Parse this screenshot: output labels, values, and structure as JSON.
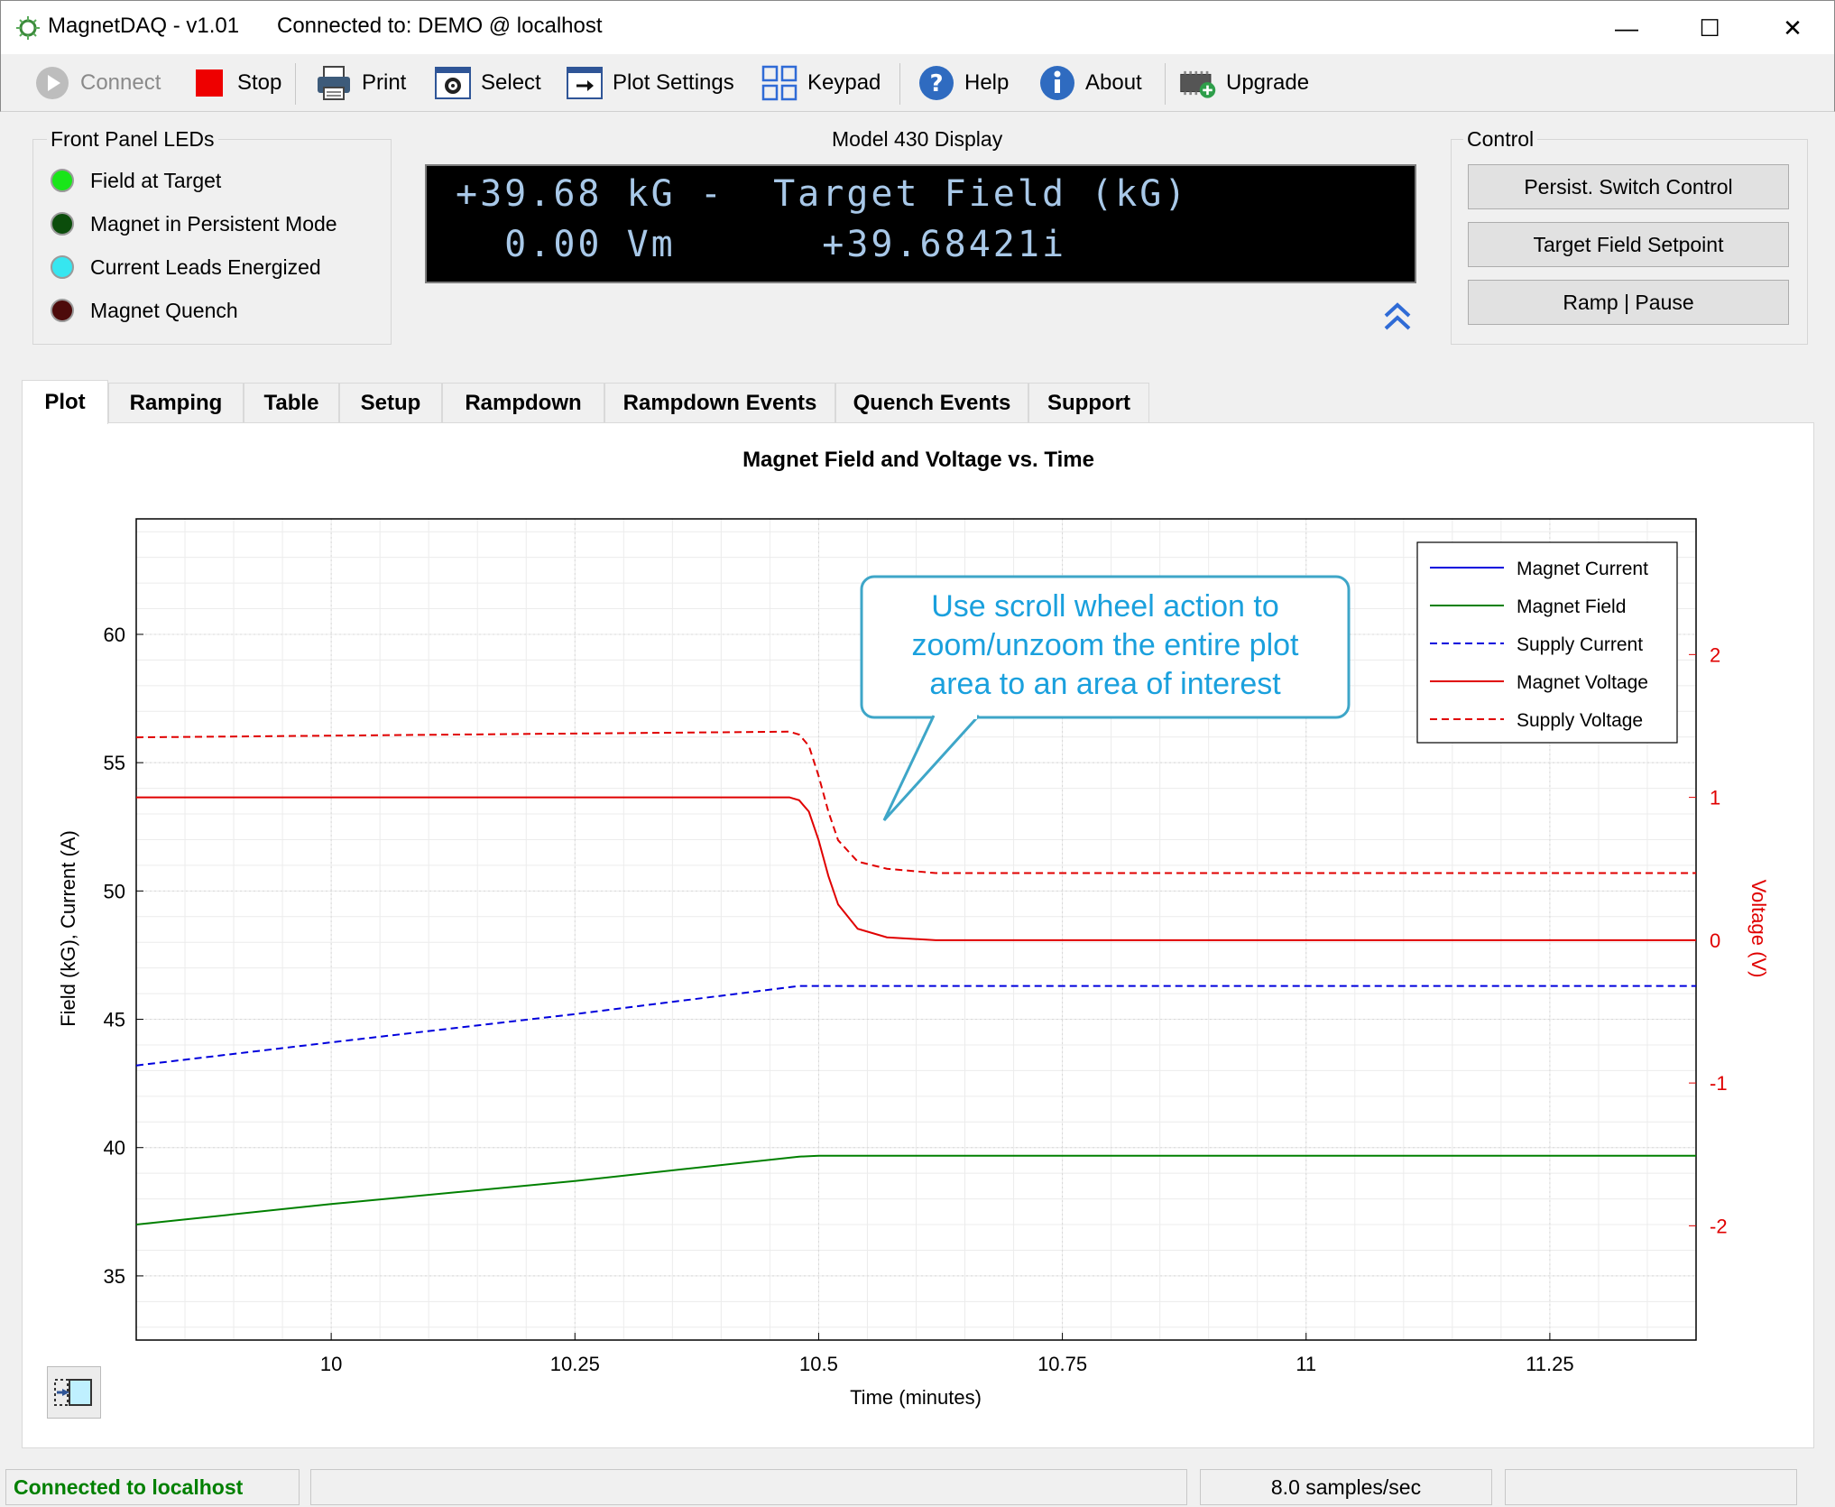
{
  "window": {
    "title": "MagnetDAQ - v1.01",
    "connection": "Connected to: DEMO @ localhost",
    "minimize_glyph": "—",
    "maximize_glyph": "☐",
    "close_glyph": "✕"
  },
  "toolbar": {
    "connect": "Connect",
    "stop": "Stop",
    "print": "Print",
    "select": "Select",
    "plot_settings": "Plot Settings",
    "keypad": "Keypad",
    "help": "Help",
    "about": "About",
    "upgrade": "Upgrade"
  },
  "leds": {
    "title": "Front Panel LEDs",
    "items": [
      {
        "label": "Field at Target",
        "color": "#19e619"
      },
      {
        "label": "Magnet in Persistent Mode",
        "color": "#0b4d0b"
      },
      {
        "label": "Current Leads Energized",
        "color": "#36e6f0"
      },
      {
        "label": "Magnet Quench",
        "color": "#4d0b0b"
      }
    ]
  },
  "display": {
    "title": "Model 430 Display",
    "line1": "+39.68 kG -  Target Field (kG)",
    "line2": "  0.00 Vm      +39.68421i"
  },
  "control": {
    "title": "Control",
    "persist_switch": "Persist. Switch Control",
    "target_field": "Target Field Setpoint",
    "ramp_pause": "Ramp | Pause"
  },
  "tabs": [
    "Plot",
    "Ramping",
    "Table",
    "Setup",
    "Rampdown",
    "Rampdown Events",
    "Quench Events",
    "Support"
  ],
  "active_tab": "Plot",
  "callout": {
    "line1": "Use scroll wheel action to",
    "line2": "zoom/unzoom the entire plot",
    "line3": "area to an area of interest"
  },
  "chart_data": {
    "type": "line",
    "title": "Magnet Field and Voltage vs. Time",
    "xlabel": "Time (minutes)",
    "ylabel": "Field (kG), Current (A)",
    "y2label": "Voltage (V)",
    "xlim": [
      9.8,
      11.4
    ],
    "ylim": [
      32.5,
      64.5
    ],
    "y2lim": [
      -2.8,
      2.95
    ],
    "xticks": [
      10,
      10.25,
      10.5,
      10.75,
      11,
      11.25
    ],
    "yticks": [
      35,
      40,
      45,
      50,
      55,
      60
    ],
    "y2ticks": [
      2,
      1,
      0,
      -1,
      -2
    ],
    "grid": true,
    "legend_position": "top-right",
    "series": [
      {
        "name": "Magnet Current",
        "axis": "left",
        "color": "#0000dd",
        "dash": false,
        "points": []
      },
      {
        "name": "Magnet Field",
        "axis": "left",
        "color": "#008000",
        "dash": false,
        "points": [
          [
            9.8,
            37.0
          ],
          [
            10.0,
            37.8
          ],
          [
            10.25,
            38.7
          ],
          [
            10.48,
            39.65
          ],
          [
            10.5,
            39.68
          ],
          [
            11.4,
            39.68
          ]
        ]
      },
      {
        "name": "Supply Current",
        "axis": "left",
        "color": "#0000dd",
        "dash": true,
        "points": [
          [
            9.8,
            43.2
          ],
          [
            10.0,
            44.1
          ],
          [
            10.25,
            45.2
          ],
          [
            10.48,
            46.3
          ],
          [
            10.5,
            46.3
          ],
          [
            11.4,
            46.3
          ]
        ]
      },
      {
        "name": "Magnet Voltage",
        "axis": "right",
        "color": "#e00000",
        "dash": false,
        "points": [
          [
            9.8,
            1.0
          ],
          [
            10.47,
            1.0
          ],
          [
            10.48,
            0.98
          ],
          [
            10.49,
            0.9
          ],
          [
            10.5,
            0.7
          ],
          [
            10.51,
            0.45
          ],
          [
            10.52,
            0.25
          ],
          [
            10.54,
            0.08
          ],
          [
            10.57,
            0.02
          ],
          [
            10.62,
            0.0
          ],
          [
            11.4,
            0.0
          ]
        ]
      },
      {
        "name": "Supply Voltage",
        "axis": "right",
        "color": "#e00000",
        "dash": true,
        "points": [
          [
            9.8,
            1.42
          ],
          [
            10.47,
            1.46
          ],
          [
            10.48,
            1.44
          ],
          [
            10.49,
            1.36
          ],
          [
            10.5,
            1.15
          ],
          [
            10.51,
            0.9
          ],
          [
            10.52,
            0.7
          ],
          [
            10.54,
            0.55
          ],
          [
            10.57,
            0.5
          ],
          [
            10.62,
            0.47
          ],
          [
            11.4,
            0.47
          ]
        ]
      }
    ]
  },
  "status": {
    "left": "Connected to localhost",
    "rate": "8.0 samples/sec",
    "left_color": "#008000"
  }
}
